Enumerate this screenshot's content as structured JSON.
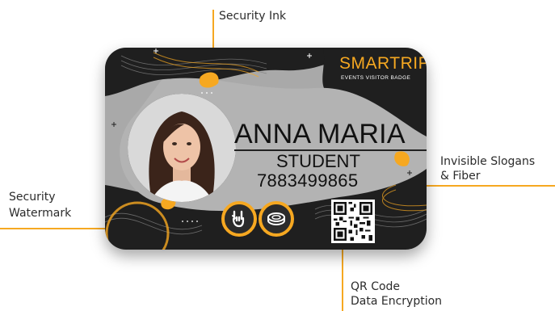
{
  "callouts": {
    "security_ink": "Security Ink",
    "invisible_slogans_line1": "Invisible Slogans",
    "invisible_slogans_line2": "& Fiber",
    "security_watermark_line1": "Security",
    "security_watermark_line2": "Watermark",
    "qr_code_line1": "QR Code",
    "qr_code_line2": "Data Encryption"
  },
  "card": {
    "brand": "SMARTRIP",
    "brand_subtitle": "EVENTS VISITOR BADGE",
    "holder_name": "ANNA MARIA",
    "role": "STUDENT",
    "id_number": "7883499865"
  },
  "colors": {
    "accent": "#f6a821",
    "card_gray": "#a9a9a9",
    "card_dark": "#1f1f1f"
  },
  "icons": [
    "rock-hand-icon",
    "coin-icon",
    "qr-code-icon"
  ]
}
